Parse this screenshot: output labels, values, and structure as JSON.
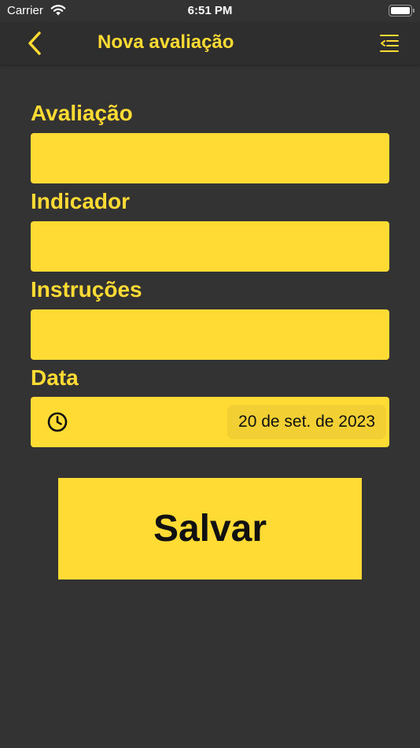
{
  "status_bar": {
    "carrier": "Carrier",
    "time": "6:51 PM"
  },
  "nav": {
    "title": "Nova avaliação",
    "back_icon": "chevron-left-icon",
    "menu_icon": "list-indent-icon"
  },
  "form": {
    "fields": [
      {
        "label": "Avaliação",
        "value": ""
      },
      {
        "label": "Indicador",
        "value": ""
      },
      {
        "label": "Instruções",
        "value": ""
      }
    ],
    "date": {
      "label": "Data",
      "icon": "clock-icon",
      "value": "20 de set. de 2023"
    },
    "save_label": "Salvar"
  },
  "colors": {
    "background": "#333333",
    "accent": "#ffdb33"
  }
}
